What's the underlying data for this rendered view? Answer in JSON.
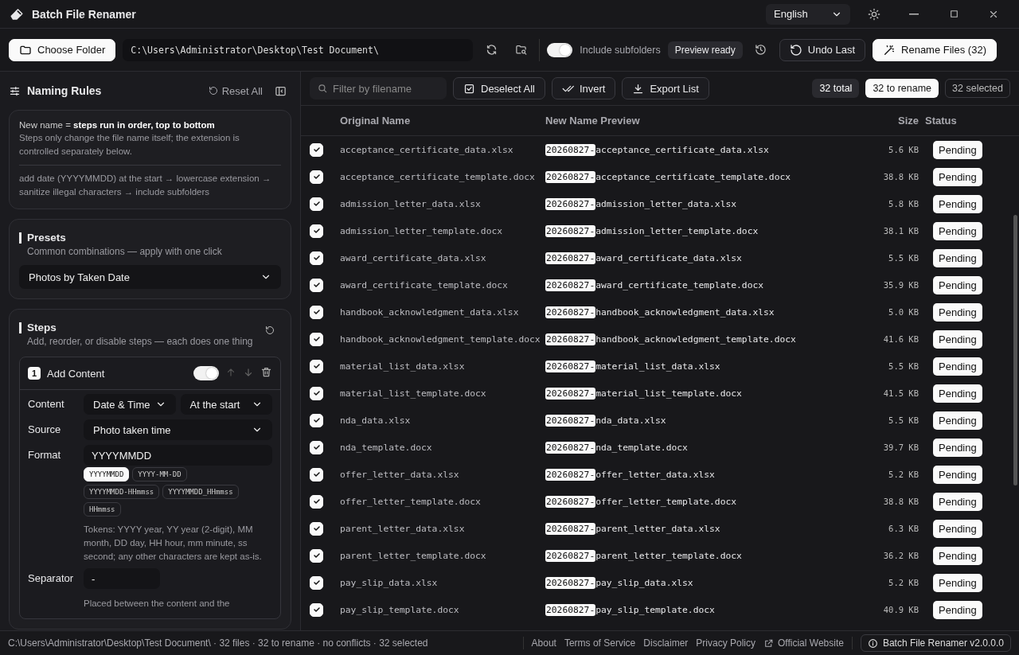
{
  "window": {
    "title": "Batch File Renamer",
    "language": "English"
  },
  "toolbar": {
    "choose_folder": "Choose Folder",
    "path": "C:\\Users\\Administrator\\Desktop\\Test Document\\",
    "include_subfolders": {
      "label": "Include subfolders",
      "on": true
    },
    "status": "Preview ready",
    "undo": "Undo Last",
    "rename": "Rename Files (32)"
  },
  "sidebar": {
    "title": "Naming Rules",
    "reset": "Reset All",
    "summary": {
      "lead": "New name = **steps run in order, top to bottom**",
      "note": "Steps only change the file name itself; the extension is controlled separately below.",
      "chain": "add date (YYYYMMDD) at the start → lowercase extension → sanitize illegal characters → include subfolders"
    },
    "presets": {
      "title": "Presets",
      "subtitle": "Common combinations — apply with one click",
      "value": "Photos by Taken Date"
    },
    "steps": {
      "title": "Steps",
      "subtitle": "Add, reorder, or disable steps — each does one thing",
      "items": [
        {
          "number": "1",
          "title": "Add Content",
          "enabled": true,
          "content_label": "Content",
          "content_type": "Date & Time",
          "position": "At the start",
          "source_label": "Source",
          "source": "Photo taken time",
          "format_label": "Format",
          "format": "YYYYMMDD",
          "format_options": [
            {
              "label": "YYYYMMDD",
              "selected": true
            },
            {
              "label": "YYYY-MM-DD",
              "selected": false
            },
            {
              "label": "YYYYMMDD-HHmmss",
              "selected": false
            },
            {
              "label": "YYYYMMDD_HHmmss",
              "selected": false
            },
            {
              "label": "HHmmss",
              "selected": false
            }
          ],
          "tokens_hint": "Tokens: YYYY year, YY year (2-digit), MM month, DD day, HH hour, mm minute, ss second; any other characters are kept as-is.",
          "separator_label": "Separator",
          "separator": "-",
          "separator_hint": "Placed between the content and the"
        }
      ]
    }
  },
  "file_list": {
    "filter_placeholder": "Filter by filename",
    "actions": [
      {
        "label": "Deselect All",
        "kind": "deselect"
      },
      {
        "label": "Invert",
        "kind": "invert"
      },
      {
        "label": "Export List",
        "kind": "export"
      }
    ],
    "counts": [
      {
        "label": "32 total",
        "kind": "muted"
      },
      {
        "label": "32 to rename",
        "kind": "highlight"
      },
      {
        "label": "32 selected",
        "kind": "outline"
      }
    ],
    "columns": [
      "Original Name",
      "New Name Preview",
      "Size",
      "Status"
    ],
    "rows": [
      {
        "checked": true,
        "original": "acceptance_certificate_data.xlsx",
        "prefix": "20260827-",
        "new_name": "acceptance_certificate_data.xlsx",
        "size": "5.6 KB",
        "status": "Pending"
      },
      {
        "checked": true,
        "original": "acceptance_certificate_template.docx",
        "prefix": "20260827-",
        "new_name": "acceptance_certificate_template.docx",
        "size": "38.8 KB",
        "status": "Pending"
      },
      {
        "checked": true,
        "original": "admission_letter_data.xlsx",
        "prefix": "20260827-",
        "new_name": "admission_letter_data.xlsx",
        "size": "5.8 KB",
        "status": "Pending"
      },
      {
        "checked": true,
        "original": "admission_letter_template.docx",
        "prefix": "20260827-",
        "new_name": "admission_letter_template.docx",
        "size": "38.1 KB",
        "status": "Pending"
      },
      {
        "checked": true,
        "original": "award_certificate_data.xlsx",
        "prefix": "20260827-",
        "new_name": "award_certificate_data.xlsx",
        "size": "5.5 KB",
        "status": "Pending"
      },
      {
        "checked": true,
        "original": "award_certificate_template.docx",
        "prefix": "20260827-",
        "new_name": "award_certificate_template.docx",
        "size": "35.9 KB",
        "status": "Pending"
      },
      {
        "checked": true,
        "original": "handbook_acknowledgment_data.xlsx",
        "prefix": "20260827-",
        "new_name": "handbook_acknowledgment_data.xlsx",
        "size": "5.0 KB",
        "status": "Pending"
      },
      {
        "checked": true,
        "original": "handbook_acknowledgment_template.docx",
        "prefix": "20260827-",
        "new_name": "handbook_acknowledgment_template.docx",
        "size": "41.6 KB",
        "status": "Pending"
      },
      {
        "checked": true,
        "original": "material_list_data.xlsx",
        "prefix": "20260827-",
        "new_name": "material_list_data.xlsx",
        "size": "5.5 KB",
        "status": "Pending"
      },
      {
        "checked": true,
        "original": "material_list_template.docx",
        "prefix": "20260827-",
        "new_name": "material_list_template.docx",
        "size": "41.5 KB",
        "status": "Pending"
      },
      {
        "checked": true,
        "original": "nda_data.xlsx",
        "prefix": "20260827-",
        "new_name": "nda_data.xlsx",
        "size": "5.5 KB",
        "status": "Pending"
      },
      {
        "checked": true,
        "original": "nda_template.docx",
        "prefix": "20260827-",
        "new_name": "nda_template.docx",
        "size": "39.7 KB",
        "status": "Pending"
      },
      {
        "checked": true,
        "original": "offer_letter_data.xlsx",
        "prefix": "20260827-",
        "new_name": "offer_letter_data.xlsx",
        "size": "5.2 KB",
        "status": "Pending"
      },
      {
        "checked": true,
        "original": "offer_letter_template.docx",
        "prefix": "20260827-",
        "new_name": "offer_letter_template.docx",
        "size": "38.8 KB",
        "status": "Pending"
      },
      {
        "checked": true,
        "original": "parent_letter_data.xlsx",
        "prefix": "20260827-",
        "new_name": "parent_letter_data.xlsx",
        "size": "6.3 KB",
        "status": "Pending"
      },
      {
        "checked": true,
        "original": "parent_letter_template.docx",
        "prefix": "20260827-",
        "new_name": "parent_letter_template.docx",
        "size": "36.2 KB",
        "status": "Pending"
      },
      {
        "checked": true,
        "original": "pay_slip_data.xlsx",
        "prefix": "20260827-",
        "new_name": "pay_slip_data.xlsx",
        "size": "5.2 KB",
        "status": "Pending"
      },
      {
        "checked": true,
        "original": "pay_slip_template.docx",
        "prefix": "20260827-",
        "new_name": "pay_slip_template.docx",
        "size": "40.9 KB",
        "status": "Pending"
      }
    ]
  },
  "status_bar": {
    "summary": "C:\\Users\\Administrator\\Desktop\\Test Document\\ · 32 files · 32 to rename · no conflicts · 32 selected",
    "links": [
      {
        "label": "About",
        "kind": "plain"
      },
      {
        "label": "Terms of Service",
        "kind": "plain"
      },
      {
        "label": "Disclaimer",
        "kind": "plain"
      },
      {
        "label": "Privacy Policy",
        "kind": "plain"
      },
      {
        "label": "Official Website",
        "kind": "external"
      }
    ],
    "version": "Batch File Renamer v2.0.0.0"
  }
}
